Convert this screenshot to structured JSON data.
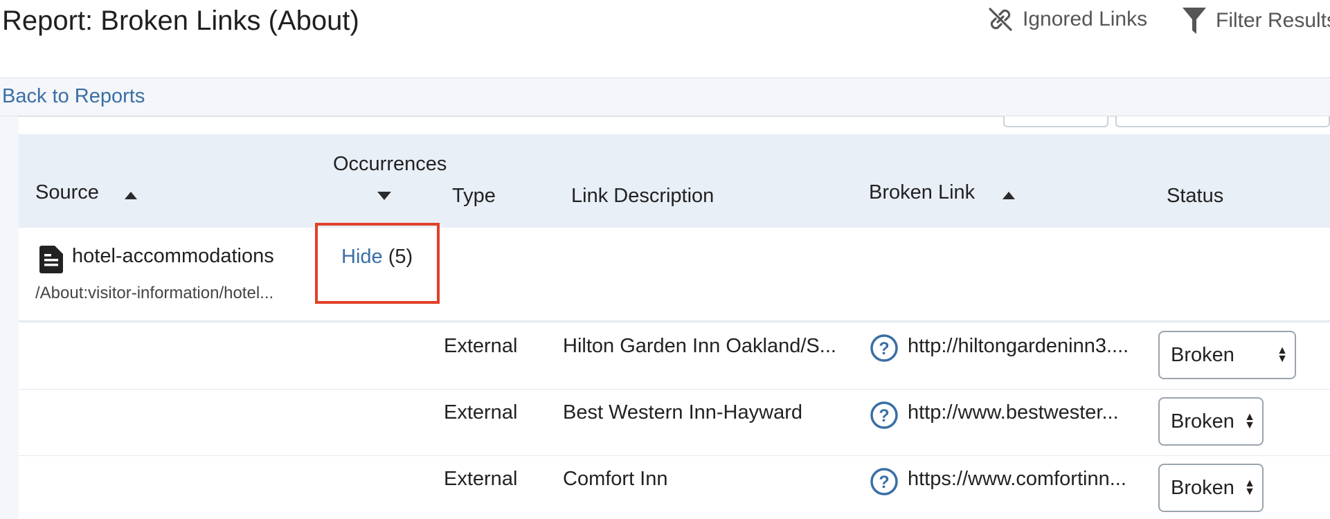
{
  "header": {
    "title": "Report: Broken Links (About)",
    "ignored_links_label": "Ignored Links",
    "filter_results_label": "Filter Results"
  },
  "subbar": {
    "back_label": "Back to Reports"
  },
  "table": {
    "columns": {
      "source": "Source",
      "occurrences": "Occurrences",
      "type": "Type",
      "link_description": "Link Description",
      "broken_link": "Broken Link",
      "status": "Status"
    },
    "group": {
      "source_name": "hotel-accommodations",
      "source_path": "/About:visitor-information/hotel...",
      "hide_label": "Hide",
      "count": "(5)"
    },
    "rows": [
      {
        "type": "External",
        "description": "Hilton Garden Inn Oakland/S...",
        "link": "http://hiltongardeninn3....",
        "status": "Broken"
      },
      {
        "type": "External",
        "description": "Best Western Inn-Hayward",
        "link": "http://www.bestwester...",
        "status": "Broken"
      },
      {
        "type": "External",
        "description": "Comfort Inn",
        "link": "https://www.comfortinn...",
        "status": "Broken"
      }
    ]
  },
  "colors": {
    "accent": "#3a6ea5",
    "header_bg": "#e9eff7",
    "highlight": "#e0402a"
  }
}
